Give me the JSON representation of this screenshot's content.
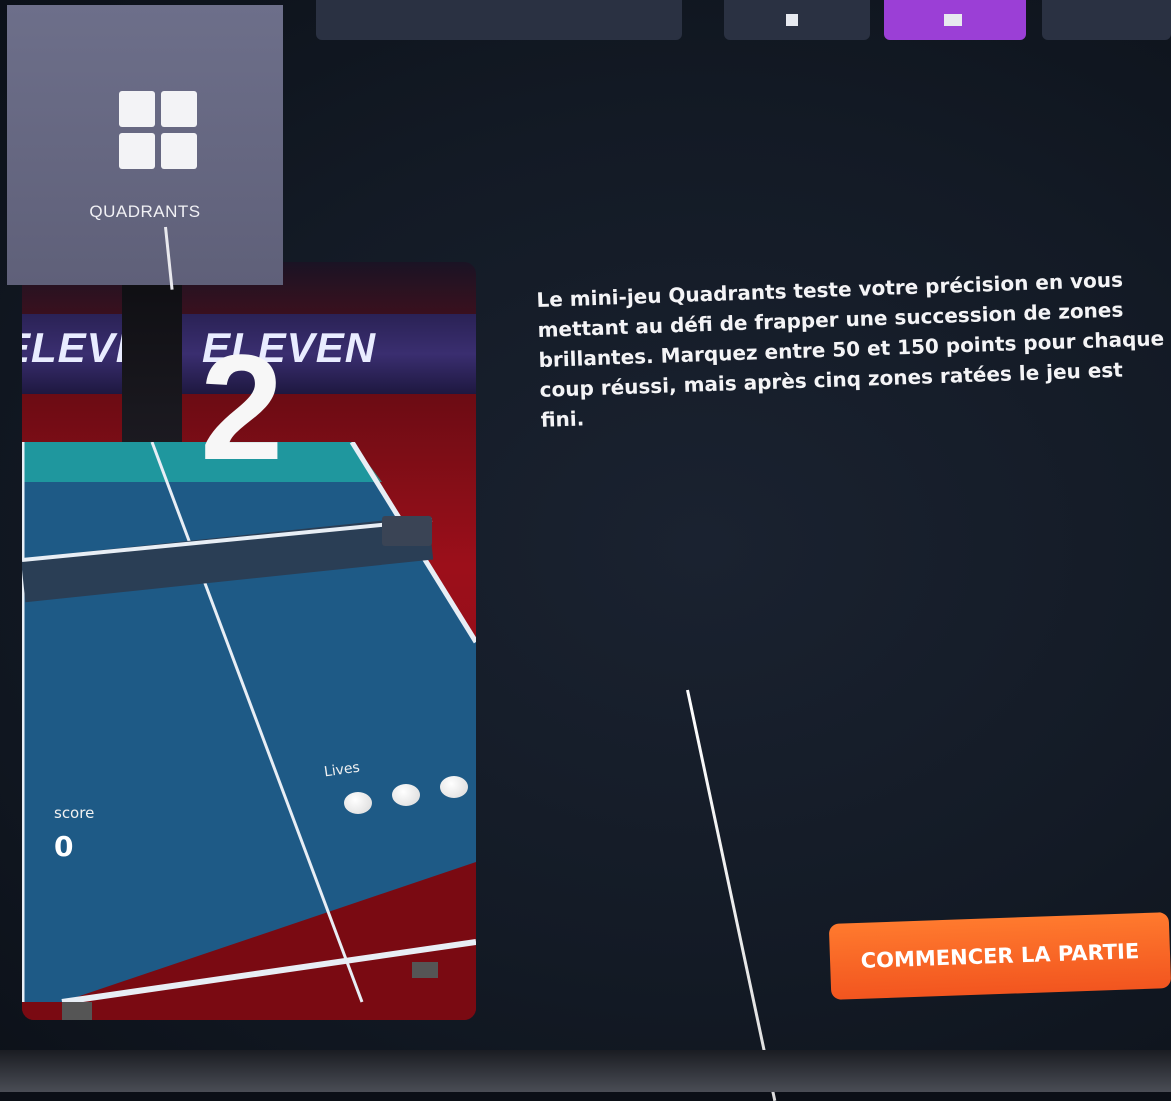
{
  "top_bar": {
    "tabs": [
      {
        "label": "",
        "accent": "#2a3142"
      },
      {
        "label": "",
        "accent": "#2a3142"
      },
      {
        "label": "",
        "accent": "#9b3fd6"
      },
      {
        "label": "",
        "accent": "#2a3142"
      }
    ]
  },
  "mode_tile": {
    "icon": "quadrants-grid-icon",
    "label": "QUADRANTS"
  },
  "preview": {
    "banner_words": [
      "ELEVEN",
      "ELEVEN"
    ],
    "countdown": "2",
    "hud": {
      "score_label": "score",
      "score_value": "0",
      "lives_label": "Lives",
      "lives_count": 3
    }
  },
  "description": "Le mini-jeu Quadrants teste votre précision en vous mettant au défi de frapper une succession de zones brillantes. Marquez entre 50 et 150 points pour chaque coup réussi, mais après cinq zones ratées le jeu est fini.",
  "start_button": {
    "label": "COMMENCER LA PARTIE",
    "color": "#f26522"
  }
}
